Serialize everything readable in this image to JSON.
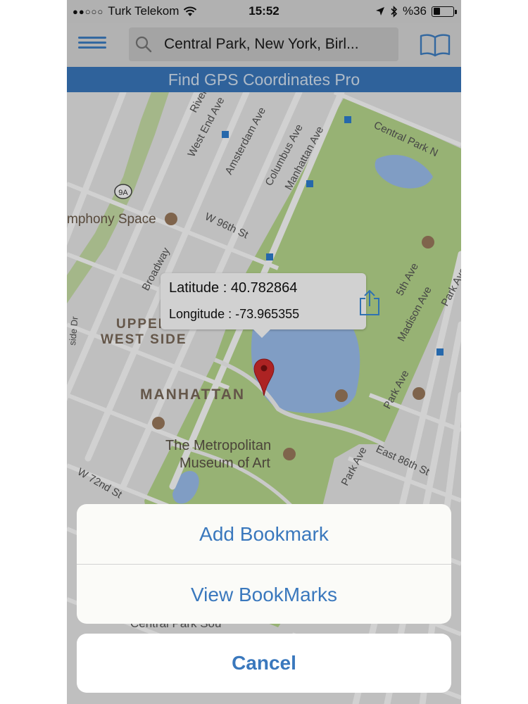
{
  "status_bar": {
    "carrier": "Turk Telekom",
    "time": "15:52",
    "battery": "%36",
    "battery_level": 0.36
  },
  "nav": {
    "search_text": "Central Park, New York, Birl..."
  },
  "banner": {
    "title": "Find GPS Coordinates Pro"
  },
  "map": {
    "labels": {
      "riverside": "Riverside Dr",
      "west_end": "West End Ave",
      "amsterdam": "Amsterdam Ave",
      "columbus": "Columbus Ave",
      "manhattan_ave": "Manhattan Ave",
      "central_park_n": "Central Park N",
      "route_9a": "9A",
      "symphony": "mphony Space",
      "w96": "W 96th St",
      "broadway": "Broadway",
      "upper": "UPPER",
      "west_side": "WEST SIDE",
      "manhattan": "MANHATTAN",
      "met_line1": "The Metropolitan",
      "met_line2": "Museum of Art",
      "fifth": "5th Ave",
      "madison": "Madison Ave",
      "park": "Park Ave",
      "east86": "East 86th St",
      "w72": "W 72nd St",
      "side_dr": "side Dr",
      "central_park_s": "Central Park Sou"
    }
  },
  "tooltip": {
    "latitude": "Latitude : 40.782864",
    "longitude": "Longitude : -73.965355"
  },
  "action_sheet": {
    "add_bookmark": "Add Bookmark",
    "view_bookmarks": "View BookMarks",
    "cancel": "Cancel"
  },
  "colors": {
    "accent": "#3a78bd",
    "park": "#b9d98e",
    "water": "#9dc0ef",
    "road": "#ffffff"
  }
}
